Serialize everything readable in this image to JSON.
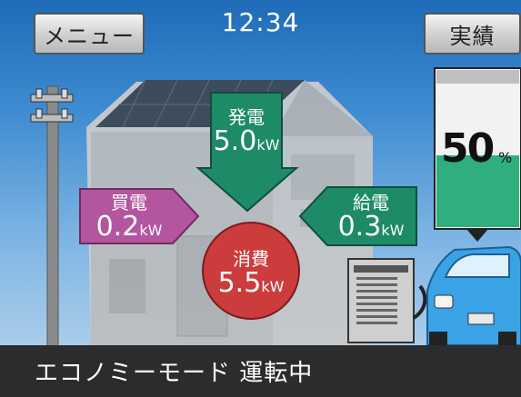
{
  "header": {
    "menu_label": "メニュー",
    "clock": "12:34",
    "results_label": "実績"
  },
  "flows": {
    "generation": {
      "label": "発電",
      "value": "5.0",
      "unit": "kW"
    },
    "purchase": {
      "label": "買電",
      "value": "0.2",
      "unit": "kW"
    },
    "supply": {
      "label": "給電",
      "value": "0.3",
      "unit": "kW"
    },
    "consumption": {
      "label": "消費",
      "value": "5.5",
      "unit": "kW"
    }
  },
  "battery_gauge": {
    "percent": 50,
    "percent_text": "50",
    "unit": "%"
  },
  "status": {
    "text": "エコノミーモード 運転中"
  },
  "colors": {
    "generation": "#1d8a68",
    "purchase": "#b4559f",
    "supply": "#1d8a68",
    "consumption": "#cc3c3c",
    "gauge_fill": "#2fae7e"
  }
}
